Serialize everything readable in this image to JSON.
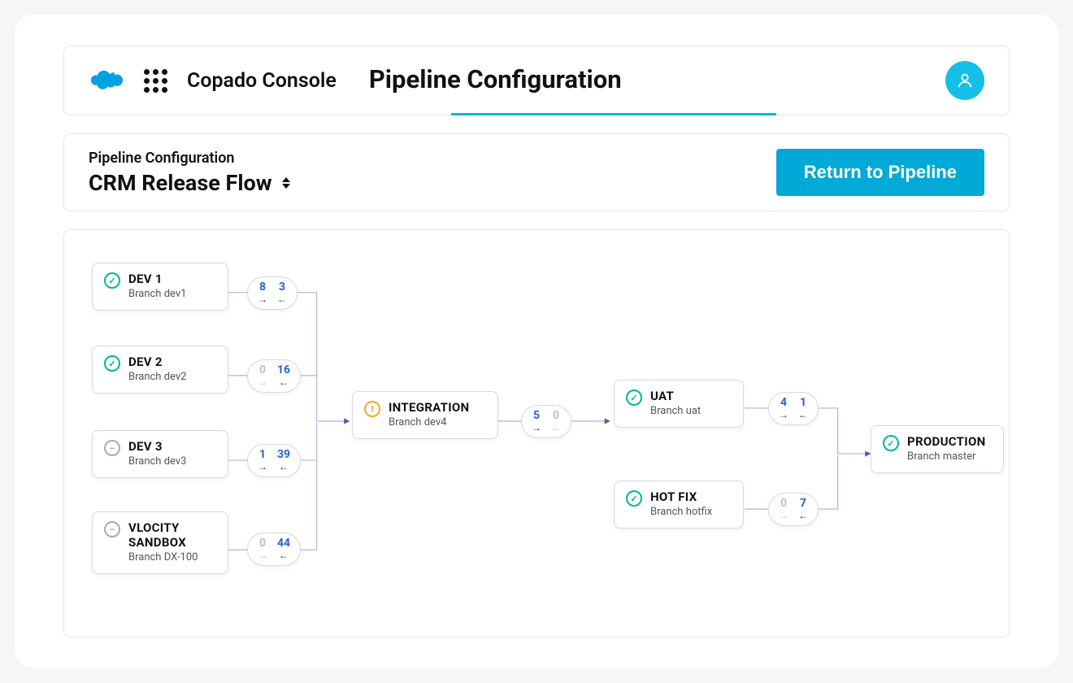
{
  "header": {
    "console_label": "Copado Console",
    "active_tab": "Pipeline Configuration"
  },
  "subheader": {
    "crumb": "Pipeline Configuration",
    "title": "CRM Release Flow",
    "button": "Return to Pipeline"
  },
  "nodes": {
    "dev1": {
      "title": "DEV 1",
      "branch": "Branch dev1",
      "status": "ok"
    },
    "dev2": {
      "title": "DEV 2",
      "branch": "Branch dev2",
      "status": "ok"
    },
    "dev3": {
      "title": "DEV 3",
      "branch": "Branch dev3",
      "status": "none"
    },
    "vloc": {
      "title": "VLOCITY SANDBOX",
      "branch": "Branch DX-100",
      "status": "none"
    },
    "integ": {
      "title": "INTEGRATION",
      "branch": "Branch dev4",
      "status": "warn"
    },
    "uat": {
      "title": "UAT",
      "branch": "Branch uat",
      "status": "ok"
    },
    "hotfix": {
      "title": "HOT FIX",
      "branch": "Branch hotfix",
      "status": "ok"
    },
    "prod": {
      "title": "PRODUCTION",
      "branch": "Branch master",
      "status": "ok"
    }
  },
  "pills": {
    "p_dev1": {
      "fwd": "8",
      "back": "3",
      "fwd_muted": false,
      "back_muted": false
    },
    "p_dev2": {
      "fwd": "0",
      "back": "16",
      "fwd_muted": true,
      "back_muted": false
    },
    "p_dev3": {
      "fwd": "1",
      "back": "39",
      "fwd_muted": false,
      "back_muted": false
    },
    "p_vloc": {
      "fwd": "0",
      "back": "44",
      "fwd_muted": true,
      "back_muted": false
    },
    "p_integ": {
      "fwd": "5",
      "back": "0",
      "fwd_muted": false,
      "back_muted": true
    },
    "p_uat": {
      "fwd": "4",
      "back": "1",
      "fwd_muted": false,
      "back_muted": false
    },
    "p_hotfix": {
      "fwd": "0",
      "back": "7",
      "fwd_muted": true,
      "back_muted": false
    }
  }
}
